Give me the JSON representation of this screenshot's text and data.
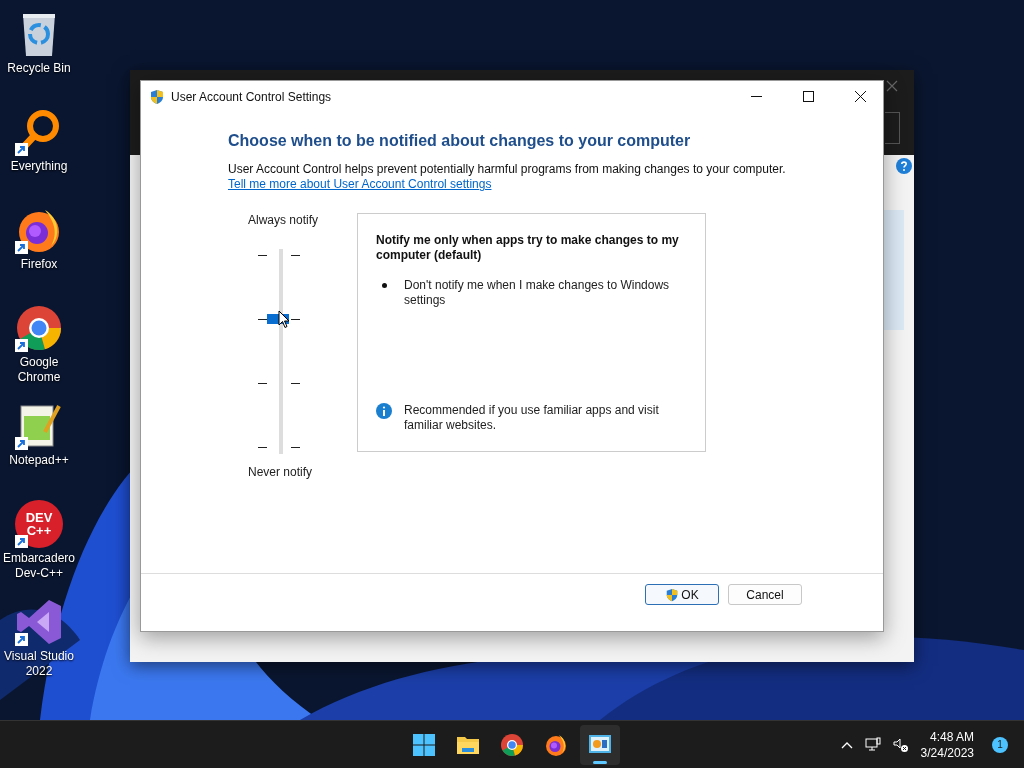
{
  "desktop_icons": [
    {
      "label": "Recycle Bin",
      "kind": "recycle",
      "shortcut": false
    },
    {
      "label": "Everything",
      "kind": "everything",
      "shortcut": true
    },
    {
      "label": "Firefox",
      "kind": "firefox",
      "shortcut": true
    },
    {
      "label": "Google Chrome",
      "kind": "chrome",
      "shortcut": true
    },
    {
      "label": "Notepad++",
      "kind": "notepad",
      "shortcut": true
    },
    {
      "label": "Embarcadero Dev-C++",
      "kind": "devcpp",
      "shortcut": true,
      "logo_lines": [
        "DEV",
        "C++"
      ]
    },
    {
      "label": "Visual Studio 2022",
      "kind": "vs",
      "shortcut": true
    }
  ],
  "dialog": {
    "title": "User Account Control Settings",
    "heading": "Choose when to be notified about changes to your computer",
    "description": "User Account Control helps prevent potentially harmful programs from making changes to your computer.",
    "link": "Tell me more about User Account Control settings",
    "slider": {
      "top_label": "Always notify",
      "bottom_label": "Never notify",
      "level": 0.667
    },
    "setting_box": {
      "title": "Notify me only when apps try to make changes to my computer (default)",
      "bullets": [
        "Don't notify me when I make changes to Windows settings"
      ],
      "note": "Recommended if you use familiar apps and visit familiar websites."
    },
    "buttons": [
      {
        "label": "OK",
        "default": true,
        "shield": true
      },
      {
        "label": "Cancel",
        "default": false,
        "shield": false
      }
    ]
  },
  "taskbar": {
    "apps": [
      {
        "kind": "start",
        "selected": false
      },
      {
        "kind": "explorer",
        "selected": false
      },
      {
        "kind": "chrome",
        "selected": false
      },
      {
        "kind": "firefox",
        "selected": false
      },
      {
        "kind": "uac",
        "selected": true
      }
    ],
    "time": "4:48 AM",
    "date": "3/24/2023",
    "notifications": "1"
  }
}
